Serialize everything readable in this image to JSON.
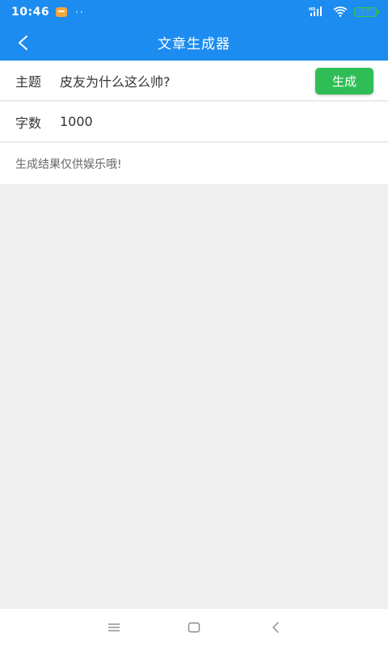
{
  "status_bar": {
    "time": "10:46",
    "dots": "··",
    "network": "HD",
    "battery": "77"
  },
  "header": {
    "title": "文章生成器"
  },
  "form": {
    "topic_label": "主题",
    "topic_value": "皮友为什么这么帅?",
    "generate_label": "生成",
    "count_label": "字数",
    "count_value": "1000"
  },
  "notice": {
    "text": "生成结果仅供娱乐哦!"
  },
  "colors": {
    "primary": "#1d8cf0",
    "button_green": "#2fbe55",
    "background": "#efefef"
  }
}
